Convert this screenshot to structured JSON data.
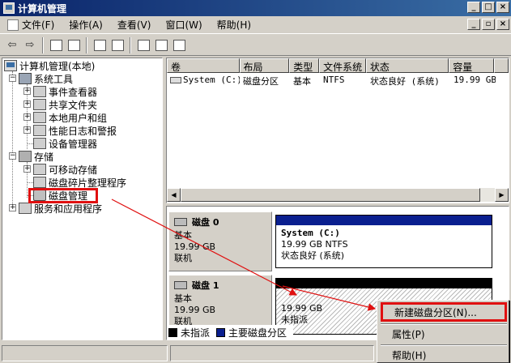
{
  "window": {
    "title": "计算机管理"
  },
  "menubar": {
    "items": [
      "文件(F)",
      "操作(A)",
      "查看(V)",
      "窗口(W)",
      "帮助(H)"
    ]
  },
  "tree": {
    "root": "计算机管理(本地)",
    "system_tools": "系统工具",
    "event_viewer": "事件查看器",
    "shared_folders": "共享文件夹",
    "local_users": "本地用户和组",
    "perf_logs": "性能日志和警报",
    "device_manager": "设备管理器",
    "storage": "存储",
    "removable": "可移动存储",
    "defrag": "磁盘碎片整理程序",
    "disk_mgmt": "磁盘管理",
    "services": "服务和应用程序"
  },
  "volume_list": {
    "columns": [
      "卷",
      "布局",
      "类型",
      "文件系统",
      "状态",
      "容量"
    ],
    "rows": [
      [
        "System (C:)",
        "磁盘分区",
        "基本",
        "NTFS",
        "状态良好 (系统)",
        "19.99 GB"
      ]
    ]
  },
  "disks": [
    {
      "name": "磁盘 0",
      "type": "基本",
      "size": "19.99 GB",
      "status": "联机",
      "partition": {
        "name": "System  (C:)",
        "size_fs": "19.99 GB NTFS",
        "status": "状态良好 (系统)",
        "bar_color": "#0a1f8f"
      }
    },
    {
      "name": "磁盘 1",
      "type": "基本",
      "size": "19.99 GB",
      "status": "联机",
      "partition": {
        "name": "",
        "size_fs": "19.99 GB",
        "status": "未指派",
        "bar_color": "#000000"
      }
    }
  ],
  "legend": {
    "unallocated": "未指派",
    "unallocated_color": "#000000",
    "primary": "主要磁盘分区",
    "primary_color": "#0a1f8f"
  },
  "context_menu": {
    "new_partition": "新建磁盘分区(N)...",
    "properties": "属性(P)",
    "help": "帮助(H)"
  },
  "annotation_color": "#e01010"
}
